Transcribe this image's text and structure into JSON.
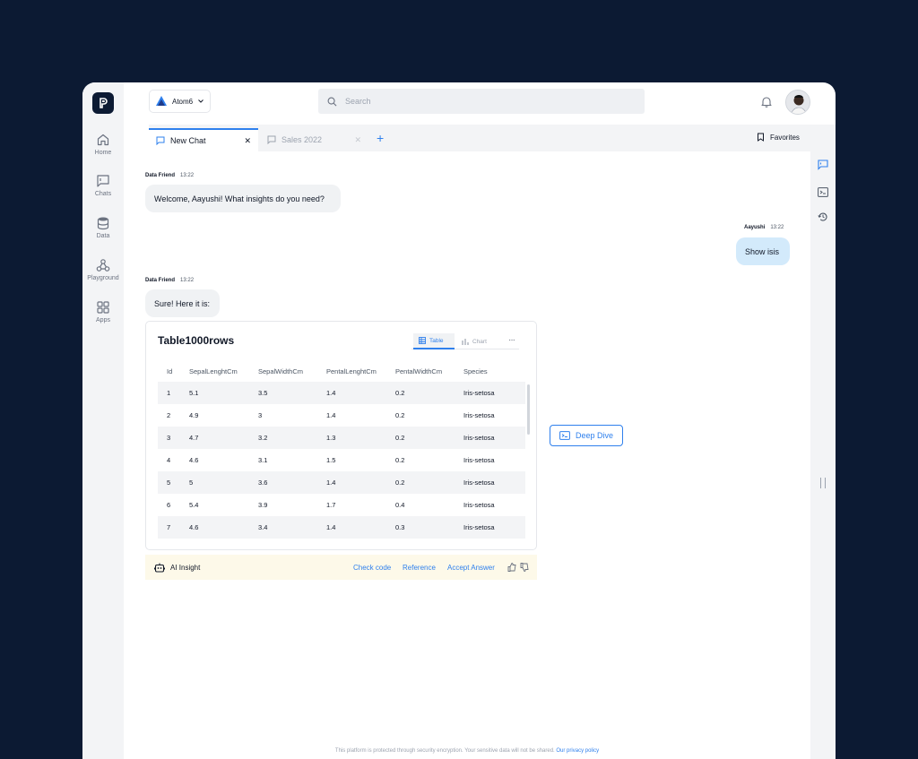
{
  "colors": {
    "background": "#0c1a33",
    "accent": "#2f80ed",
    "user_bubble": "#d3eafb",
    "insight_bg": "#fdf9e9"
  },
  "nav": [
    {
      "label": "Home",
      "icon": "home-icon"
    },
    {
      "label": "Chats",
      "icon": "chat-icon"
    },
    {
      "label": "Data",
      "icon": "database-icon"
    },
    {
      "label": "Playground",
      "icon": "playground-icon"
    },
    {
      "label": "Apps",
      "icon": "apps-icon"
    }
  ],
  "header": {
    "workspace": "Atom6",
    "search_placeholder": "Search"
  },
  "tabs": [
    {
      "label": "New Chat",
      "active": true
    },
    {
      "label": "Sales 2022",
      "active": false
    }
  ],
  "add_tab_label": "+",
  "favorites_label": "Favorites",
  "messages": [
    {
      "sender": "Data Friend",
      "time": "13:22",
      "text": "Welcome, Aayushi! What insights do you need?"
    },
    {
      "sender": "Aayushi",
      "time": "13:22",
      "text": "Show isis"
    },
    {
      "sender": "Data Friend",
      "time": "13:22",
      "text": "Sure! Here it is:"
    }
  ],
  "table_card": {
    "title": "Table1000rows",
    "view_tabs": [
      "Table",
      "Chart"
    ],
    "more_label": "···",
    "columns": [
      "Id",
      "SepalLenghtCm",
      "SepalWidthCm",
      "PentalLenghtCm",
      "PentalWidthCm",
      "Species"
    ],
    "rows": [
      [
        "1",
        "5.1",
        "3.5",
        "1.4",
        "0.2",
        "Iris-setosa"
      ],
      [
        "2",
        "4.9",
        "3",
        "1.4",
        "0.2",
        "Iris-setosa"
      ],
      [
        "3",
        "4.7",
        "3.2",
        "1.3",
        "0.2",
        "Iris-setosa"
      ],
      [
        "4",
        "4.6",
        "3.1",
        "1.5",
        "0.2",
        "Iris-setosa"
      ],
      [
        "5",
        "5",
        "3.6",
        "1.4",
        "0.2",
        "Iris-setosa"
      ],
      [
        "6",
        "5.4",
        "3.9",
        "1.7",
        "0.4",
        "Iris-setosa"
      ],
      [
        "7",
        "4.6",
        "3.4",
        "1.4",
        "0.3",
        "Iris-setosa"
      ]
    ]
  },
  "deep_dive_label": "Deep Dive",
  "insight": {
    "label": "AI Insight",
    "check_code": "Check code",
    "reference": "Reference",
    "accept": "Accept Answer"
  },
  "footer": {
    "text": "This platform is protected through security encryption. Your sensitive data will not be shared.",
    "link": "Our privacy policy"
  }
}
